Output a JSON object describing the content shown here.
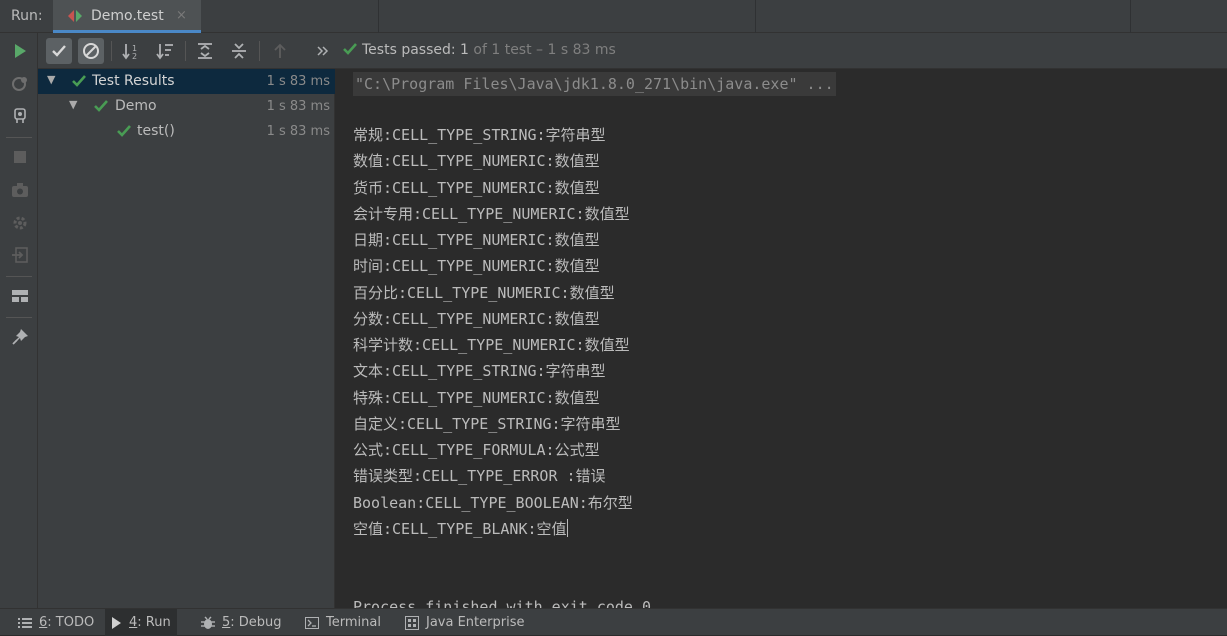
{
  "tabbar": {
    "run_label": "Run:",
    "tab_title": "Demo.test",
    "tab_close": "×"
  },
  "toolbar": {
    "status_passed": "Tests passed: 1",
    "status_detail": " of 1 test – 1 s 83 ms"
  },
  "tree": {
    "items": [
      {
        "label": "Test Results",
        "time": "1 s 83 ms"
      },
      {
        "label": "Demo",
        "time": "1 s 83 ms"
      },
      {
        "label": "test()",
        "time": "1 s 83 ms"
      }
    ]
  },
  "console": {
    "command": "\"C:\\Program Files\\Java\\jdk1.8.0_271\\bin\\java.exe\" ...",
    "lines": [
      "常规:CELL_TYPE_STRING:字符串型",
      "数值:CELL_TYPE_NUMERIC:数值型",
      "货币:CELL_TYPE_NUMERIC:数值型",
      "会计专用:CELL_TYPE_NUMERIC:数值型",
      "日期:CELL_TYPE_NUMERIC:数值型",
      "时间:CELL_TYPE_NUMERIC:数值型",
      "百分比:CELL_TYPE_NUMERIC:数值型",
      "分数:CELL_TYPE_NUMERIC:数值型",
      "科学计数:CELL_TYPE_NUMERIC:数值型",
      "文本:CELL_TYPE_STRING:字符串型",
      "特殊:CELL_TYPE_NUMERIC:数值型",
      "自定义:CELL_TYPE_STRING:字符串型",
      "公式:CELL_TYPE_FORMULA:公式型",
      "错误类型:CELL_TYPE_ERROR :错误",
      "Boolean:CELL_TYPE_BOOLEAN:布尔型",
      "空值:CELL_TYPE_BLANK:空值"
    ],
    "finish": "Process finished with exit code 0"
  },
  "bottombar": {
    "todo_num": "6",
    "todo_label": ": TODO",
    "run_num": "4",
    "run_label": ": Run",
    "debug_num": "5",
    "debug_label": ": Debug",
    "terminal_label": "Terminal",
    "java_enterprise_label": "Java Enterprise"
  },
  "colors": {
    "pass_green": "#499c54",
    "run_green": "#59a869",
    "tab_underline": "#4a88c7",
    "selection": "#0d293e"
  }
}
